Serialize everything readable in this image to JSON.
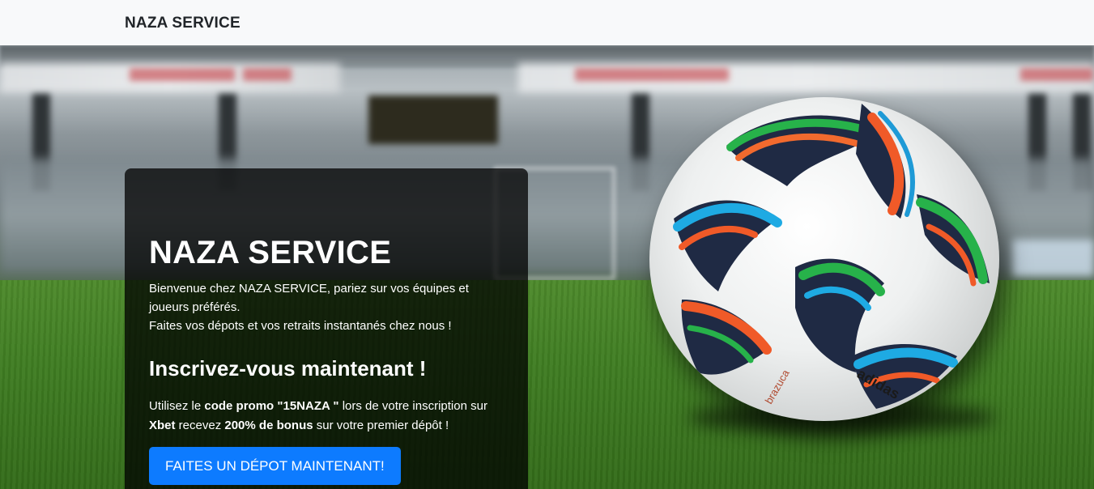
{
  "navbar": {
    "brand": "NAZA SERVICE"
  },
  "hero": {
    "title": "NAZA SERVICE",
    "intro_line1": "Bienvenue chez NAZA SERVICE, pariez sur vos équipes et joueurs préférés.",
    "intro_line2": "Faites vos dépots et vos retraits instantanés chez nous !",
    "subtitle": "Inscrivez-vous maintenant !",
    "promo": {
      "t1": "Utilisez le ",
      "b1": "code promo \"15NAZA \"",
      "t2": " lors de votre inscription sur ",
      "b2": "Xbet",
      "t3": " recevez ",
      "b3": "200% de bonus",
      "t4": " sur votre premier dépôt !"
    },
    "cta_label": "FAITES UN DÉPOT MAINTENANT!"
  },
  "ball": {
    "brand_text": "adidas",
    "model_text": "brazuca"
  },
  "colors": {
    "accent": "#0d7bff",
    "card_bg": "rgba(0,0,0,0.75)",
    "navbar_bg": "#f8f9fa"
  }
}
